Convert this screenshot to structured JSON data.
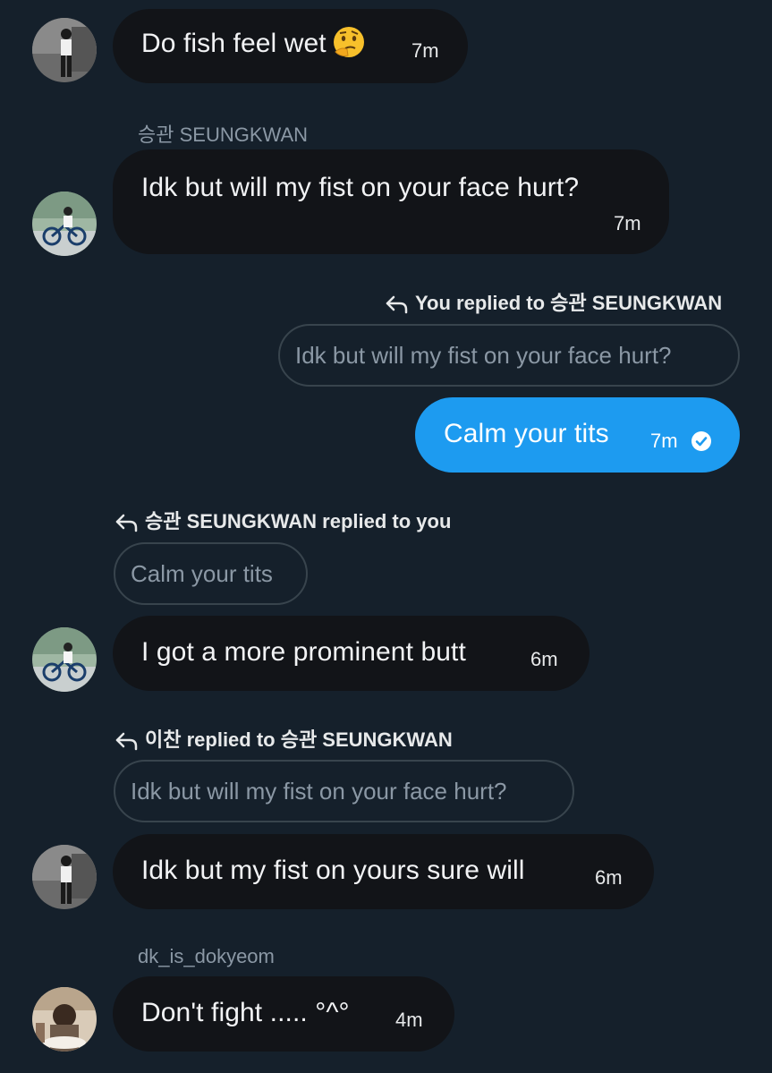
{
  "messages": [
    {
      "id": "m1",
      "text": "Do fish feel wet",
      "emoji": "thinking-face",
      "time": "7m"
    },
    {
      "id": "m2",
      "sender": "승관 SEUNGKWAN",
      "text": "Idk but will my fist on your face hurt?",
      "time": "7m"
    },
    {
      "id": "m3",
      "reply_label": "You replied to 승관 SEUNGKWAN",
      "quote": "Idk but will my fist on your face hurt?",
      "text": "Calm your tits",
      "time": "7m",
      "status": "seen"
    },
    {
      "id": "m4",
      "reply_label": "승관 SEUNGKWAN replied to you",
      "quote": "Calm your tits",
      "text": "I got a more prominent butt",
      "time": "6m"
    },
    {
      "id": "m5",
      "reply_label": "이찬 replied to 승관 SEUNGKWAN",
      "quote": "Idk but will my fist on your face hurt?",
      "text": "Idk but my fist on yours sure will",
      "time": "6m"
    },
    {
      "id": "m6",
      "sender": "dk_is_dokyeom",
      "text": "Don't fight ..... °^°",
      "time": "4m"
    }
  ],
  "colors": {
    "background": "#15202b",
    "received_bubble": "#121418",
    "sent_bubble": "#1d9bf0",
    "quote_border": "#38444d",
    "muted_text": "#8b98a5"
  }
}
